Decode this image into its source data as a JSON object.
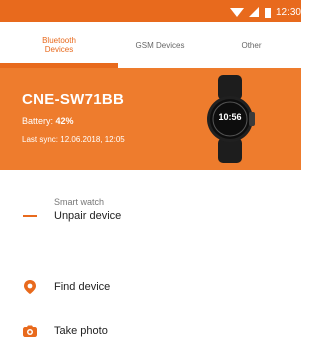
{
  "status": {
    "time": "12:30",
    "icons": [
      "wifi-icon",
      "signal-icon",
      "battery-icon"
    ]
  },
  "tabs": [
    {
      "label": "Bluetooth\nDevices",
      "active": true
    },
    {
      "label": "GSM Devices",
      "active": false
    },
    {
      "label": "Other",
      "active": false
    }
  ],
  "device": {
    "name": "CNE-SW71BB",
    "battery_label": "Battery:",
    "battery_value": "42%",
    "sync_label": "Last sync:",
    "sync_value": "12.06.2018, 12:05",
    "watch_time": "10:56"
  },
  "section": {
    "label": "Smart watch"
  },
  "menu": [
    {
      "label": "Unpair device",
      "icon": "minus-icon"
    },
    {
      "label": "Find device",
      "icon": "location-pin-icon"
    },
    {
      "label": "Take photo",
      "icon": "camera-icon"
    }
  ],
  "colors": {
    "accent": "#e86a1d",
    "header": "#ee7c2d"
  }
}
